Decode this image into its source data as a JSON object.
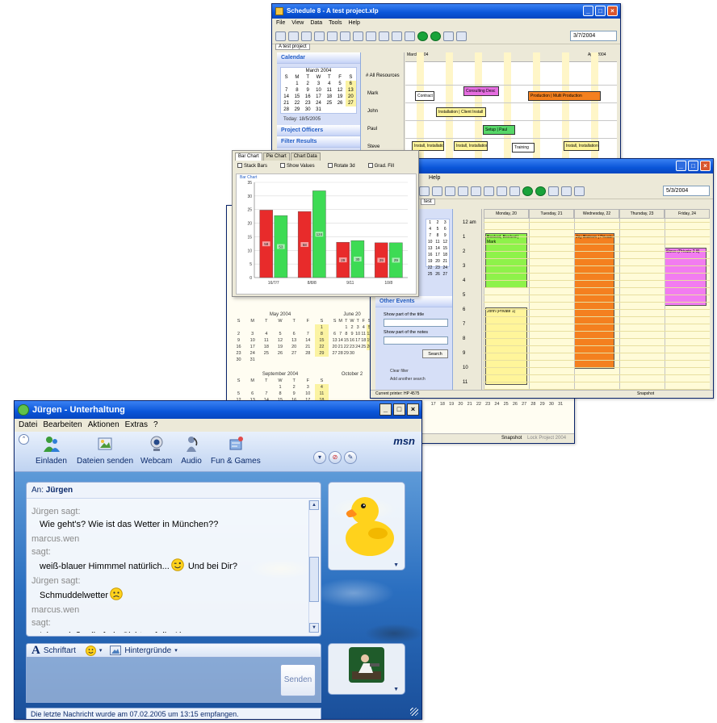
{
  "gantt_window": {
    "title": "Schedule 8 - A test project.xlp",
    "menu": [
      "File",
      "View",
      "Data",
      "Tools",
      "Help"
    ],
    "date_value": "3/7/2004",
    "tab": "A test project",
    "sidepanel_title": "Calendar",
    "mini_month": "March 2004",
    "today_label": "Today: 18/5/2005",
    "section_1": "Project Officers",
    "section_2": "Filter Results",
    "timeline_left": "March 2004",
    "timeline_right": "April 2004",
    "resource_header": "# All Resources",
    "resources": [
      "Mark",
      "John",
      "Paul",
      "Steve"
    ],
    "tasks": [
      {
        "label": "Contract",
        "color": "#ffffff"
      },
      {
        "label": "Consulting Desc",
        "color": "#e56de0"
      },
      {
        "label": "Production | Multi Production",
        "color": "#f4801f"
      },
      {
        "label": "Installation | Client Install",
        "color": "#fff59a"
      },
      {
        "label": "Setup | Paul",
        "color": "#56d768"
      },
      {
        "label": "Install, Installation",
        "color": "#fff59a"
      },
      {
        "label": "Install, Installation",
        "color": "#fff59a"
      },
      {
        "label": "Training",
        "color": "#ffffff"
      },
      {
        "label": "Install, Installation",
        "color": "#fff59a"
      }
    ]
  },
  "chart_window": {
    "tabs": [
      "Bar Chart",
      "Pie Chart",
      "Chart Data"
    ],
    "options": [
      "Stack Bars",
      "Show Values",
      "Rotate 3d",
      "Grad. Fill"
    ],
    "subtitle": "Bar Chart"
  },
  "chart_data": {
    "type": "bar",
    "categories": [
      "16/7/7",
      "8/8/8",
      "9/11",
      "10/8"
    ],
    "series": [
      {
        "name": "",
        "color": "#e82b2b",
        "values": [
          24.8,
          24.3,
          13.0,
          12.8
        ]
      },
      {
        "name": "",
        "color": "#3ddb54",
        "values": [
          22.8,
          31.9,
          13.6,
          12.8
        ]
      }
    ],
    "value_labels": [
      [
        "58",
        "58",
        "29",
        "29"
      ],
      [
        "53",
        "124",
        "30",
        "29"
      ]
    ],
    "ylim": [
      0,
      35
    ],
    "yticks": [
      0,
      5,
      10,
      15,
      20,
      25,
      30,
      35
    ],
    "grid": true,
    "title": "",
    "xlabel": "",
    "ylabel": ""
  },
  "week_window": {
    "menu": [
      "Help"
    ],
    "date_value": "5/3/2004",
    "tab": "test",
    "days": [
      "Monday, 20",
      "Tuesday, 21",
      "Wednesday, 22",
      "Thursday, 23",
      "Friday, 24"
    ],
    "hours": [
      "12 am",
      "1",
      "2",
      "3",
      "4",
      "5",
      "6",
      "7",
      "8",
      "9",
      "10",
      "11"
    ],
    "appointments": [
      {
        "label": "Booked, Booked | Mark",
        "color": "#8ef24a"
      },
      {
        "label": "John (Private 1)",
        "color": "#fff59a"
      },
      {
        "label": "Joy Bistrom | Private",
        "color": "#f4801f"
      },
      {
        "label": "Steve (Private 2 8)",
        "color": "#f27cf0"
      }
    ],
    "filter_title": "Other Events",
    "filter_label_1": "Show part of the title",
    "filter_label_2": "Show part of the notes",
    "search_label": "Search",
    "link_1": "Clear filter",
    "link_2": "Add another search",
    "status_left": "Current printer: HP 4575",
    "status_right": "Snapshot"
  },
  "back_window": {
    "month_1": "May 2004",
    "month_2": "June 20",
    "month_3": "September 2004",
    "month_4": "October 2",
    "status_1": "Snapshot",
    "status_2": "Lock Project 2004"
  },
  "msn": {
    "title": "Jürgen - Unterhaltung",
    "menu": [
      "Datei",
      "Bearbeiten",
      "Aktionen",
      "Extras",
      "?"
    ],
    "tools": [
      "Einladen",
      "Dateien senden",
      "Webcam",
      "Audio",
      "Fun & Games"
    ],
    "logo": "msn",
    "to_label": "An:",
    "to_name": "Jürgen",
    "history": [
      {
        "kind": "who",
        "text": "Jürgen sagt:"
      },
      {
        "kind": "msg",
        "text": "Wie geht's? Wie ist das Wetter in München??"
      },
      {
        "kind": "who",
        "text": "marcus.wen"
      },
      {
        "kind": "who",
        "text": "sagt:"
      },
      {
        "kind": "msg",
        "text": "weiß-blauer Himmmel natürlich...",
        "emoji": "wink",
        "after": " Und bei Dir?"
      },
      {
        "kind": "who",
        "text": "Jürgen sagt:"
      },
      {
        "kind": "msg",
        "text": "Schmuddelwetter",
        "emoji": "sad",
        "after": ""
      },
      {
        "kind": "who",
        "text": "marcus.wen"
      },
      {
        "kind": "who",
        "text": "sagt:"
      },
      {
        "kind": "msg",
        "text": "Ich genieße die freie Sicht auf die Alpen..",
        "emoji": "",
        "after": ""
      }
    ],
    "font_label": "Schriftart",
    "backgrounds_label": "Hintergründe",
    "send_label": "Senden",
    "status": "Die letzte Nachricht wurde am 07.02.2005 um 13:15 empfangen."
  }
}
